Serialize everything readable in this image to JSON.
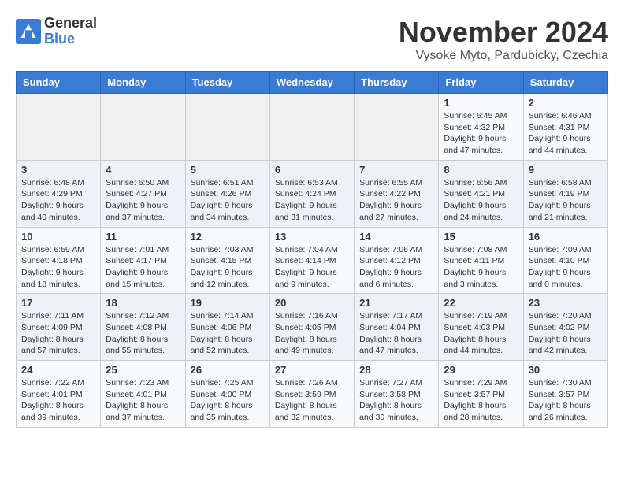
{
  "header": {
    "logo_line1": "General",
    "logo_line2": "Blue",
    "month": "November 2024",
    "location": "Vysoke Myto, Pardubicky, Czechia"
  },
  "days_of_week": [
    "Sunday",
    "Monday",
    "Tuesday",
    "Wednesday",
    "Thursday",
    "Friday",
    "Saturday"
  ],
  "weeks": [
    [
      {
        "day": "",
        "info": ""
      },
      {
        "day": "",
        "info": ""
      },
      {
        "day": "",
        "info": ""
      },
      {
        "day": "",
        "info": ""
      },
      {
        "day": "",
        "info": ""
      },
      {
        "day": "1",
        "info": "Sunrise: 6:45 AM\nSunset: 4:32 PM\nDaylight: 9 hours and 47 minutes."
      },
      {
        "day": "2",
        "info": "Sunrise: 6:46 AM\nSunset: 4:31 PM\nDaylight: 9 hours and 44 minutes."
      }
    ],
    [
      {
        "day": "3",
        "info": "Sunrise: 6:48 AM\nSunset: 4:29 PM\nDaylight: 9 hours and 40 minutes."
      },
      {
        "day": "4",
        "info": "Sunrise: 6:50 AM\nSunset: 4:27 PM\nDaylight: 9 hours and 37 minutes."
      },
      {
        "day": "5",
        "info": "Sunrise: 6:51 AM\nSunset: 4:26 PM\nDaylight: 9 hours and 34 minutes."
      },
      {
        "day": "6",
        "info": "Sunrise: 6:53 AM\nSunset: 4:24 PM\nDaylight: 9 hours and 31 minutes."
      },
      {
        "day": "7",
        "info": "Sunrise: 6:55 AM\nSunset: 4:22 PM\nDaylight: 9 hours and 27 minutes."
      },
      {
        "day": "8",
        "info": "Sunrise: 6:56 AM\nSunset: 4:21 PM\nDaylight: 9 hours and 24 minutes."
      },
      {
        "day": "9",
        "info": "Sunrise: 6:58 AM\nSunset: 4:19 PM\nDaylight: 9 hours and 21 minutes."
      }
    ],
    [
      {
        "day": "10",
        "info": "Sunrise: 6:59 AM\nSunset: 4:18 PM\nDaylight: 9 hours and 18 minutes."
      },
      {
        "day": "11",
        "info": "Sunrise: 7:01 AM\nSunset: 4:17 PM\nDaylight: 9 hours and 15 minutes."
      },
      {
        "day": "12",
        "info": "Sunrise: 7:03 AM\nSunset: 4:15 PM\nDaylight: 9 hours and 12 minutes."
      },
      {
        "day": "13",
        "info": "Sunrise: 7:04 AM\nSunset: 4:14 PM\nDaylight: 9 hours and 9 minutes."
      },
      {
        "day": "14",
        "info": "Sunrise: 7:06 AM\nSunset: 4:12 PM\nDaylight: 9 hours and 6 minutes."
      },
      {
        "day": "15",
        "info": "Sunrise: 7:08 AM\nSunset: 4:11 PM\nDaylight: 9 hours and 3 minutes."
      },
      {
        "day": "16",
        "info": "Sunrise: 7:09 AM\nSunset: 4:10 PM\nDaylight: 9 hours and 0 minutes."
      }
    ],
    [
      {
        "day": "17",
        "info": "Sunrise: 7:11 AM\nSunset: 4:09 PM\nDaylight: 8 hours and 57 minutes."
      },
      {
        "day": "18",
        "info": "Sunrise: 7:12 AM\nSunset: 4:08 PM\nDaylight: 8 hours and 55 minutes."
      },
      {
        "day": "19",
        "info": "Sunrise: 7:14 AM\nSunset: 4:06 PM\nDaylight: 8 hours and 52 minutes."
      },
      {
        "day": "20",
        "info": "Sunrise: 7:16 AM\nSunset: 4:05 PM\nDaylight: 8 hours and 49 minutes."
      },
      {
        "day": "21",
        "info": "Sunrise: 7:17 AM\nSunset: 4:04 PM\nDaylight: 8 hours and 47 minutes."
      },
      {
        "day": "22",
        "info": "Sunrise: 7:19 AM\nSunset: 4:03 PM\nDaylight: 8 hours and 44 minutes."
      },
      {
        "day": "23",
        "info": "Sunrise: 7:20 AM\nSunset: 4:02 PM\nDaylight: 8 hours and 42 minutes."
      }
    ],
    [
      {
        "day": "24",
        "info": "Sunrise: 7:22 AM\nSunset: 4:01 PM\nDaylight: 8 hours and 39 minutes."
      },
      {
        "day": "25",
        "info": "Sunrise: 7:23 AM\nSunset: 4:01 PM\nDaylight: 8 hours and 37 minutes."
      },
      {
        "day": "26",
        "info": "Sunrise: 7:25 AM\nSunset: 4:00 PM\nDaylight: 8 hours and 35 minutes."
      },
      {
        "day": "27",
        "info": "Sunrise: 7:26 AM\nSunset: 3:59 PM\nDaylight: 8 hours and 32 minutes."
      },
      {
        "day": "28",
        "info": "Sunrise: 7:27 AM\nSunset: 3:58 PM\nDaylight: 8 hours and 30 minutes."
      },
      {
        "day": "29",
        "info": "Sunrise: 7:29 AM\nSunset: 3:57 PM\nDaylight: 8 hours and 28 minutes."
      },
      {
        "day": "30",
        "info": "Sunrise: 7:30 AM\nSunset: 3:57 PM\nDaylight: 8 hours and 26 minutes."
      }
    ]
  ]
}
